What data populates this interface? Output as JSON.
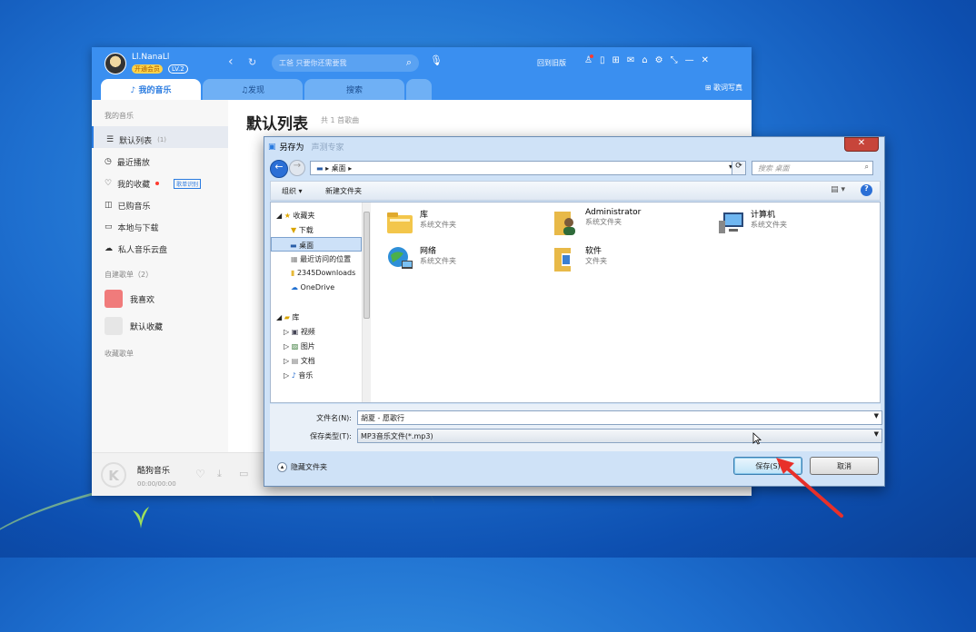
{
  "kugou": {
    "user": {
      "name": "Ll.NanaLl",
      "vip": "开通会员",
      "level": "LV.2"
    },
    "search_placeholder": "工爸 只要你还需要我",
    "top_label": "回到旧版",
    "tabs": [
      "我的音乐",
      "发现",
      "搜索",
      ""
    ],
    "lyrics_label": "歌词写真",
    "sidebar": {
      "section_my": "我的音乐",
      "items": [
        {
          "label": "默认列表",
          "count": "1"
        },
        {
          "label": "最近播放"
        },
        {
          "label": "我的收藏",
          "tag": "歌单识别"
        },
        {
          "label": "已购音乐"
        },
        {
          "label": "本地与下载"
        },
        {
          "label": "私人音乐云盘"
        }
      ],
      "section_created": "自建歌单（2）",
      "playlists": [
        "我喜欢",
        "默认收藏"
      ],
      "section_fav": "收藏歌单"
    },
    "main": {
      "title": "默认列表",
      "count": "共 1 首歌曲"
    },
    "player": {
      "title": "酷狗音乐",
      "time": "00:00/00:00"
    }
  },
  "dialog": {
    "title": "另存为",
    "behind_title": "声测专家",
    "address": "桌面",
    "search_placeholder": "搜索 桌面",
    "organize": "组织 ▾",
    "new_folder": "新建文件夹",
    "nav": [
      {
        "label": "收藏夹",
        "level": 0,
        "icon": "star-icon"
      },
      {
        "label": "下载",
        "level": 1,
        "icon": "download-folder-icon"
      },
      {
        "label": "桌面",
        "level": 1,
        "icon": "desktop-icon",
        "selected": true
      },
      {
        "label": "最近访问的位置",
        "level": 1,
        "icon": "recent-icon"
      },
      {
        "label": "2345Downloads",
        "level": 1,
        "icon": "folder-icon"
      },
      {
        "label": "OneDrive",
        "level": 1,
        "icon": "cloud-icon"
      },
      {
        "label": "库",
        "level": 0,
        "icon": "library-icon"
      },
      {
        "label": "视频",
        "level": 1,
        "icon": "video-icon"
      },
      {
        "label": "图片",
        "level": 1,
        "icon": "picture-icon"
      },
      {
        "label": "文档",
        "level": 1,
        "icon": "document-icon"
      },
      {
        "label": "音乐",
        "level": 1,
        "icon": "music-icon"
      }
    ],
    "files": [
      {
        "name": "库",
        "type": "系统文件夹",
        "icon": "library-icon"
      },
      {
        "name": "Administrator",
        "type": "系统文件夹",
        "icon": "user-folder-icon"
      },
      {
        "name": "计算机",
        "type": "系统文件夹",
        "icon": "computer-icon"
      },
      {
        "name": "网络",
        "type": "系统文件夹",
        "icon": "network-icon"
      },
      {
        "name": "软件",
        "type": "文件夹",
        "icon": "folder-icon"
      }
    ],
    "filename_label": "文件名(N):",
    "filename_value": "胡夏 - 愿歌行",
    "filetype_label": "保存类型(T):",
    "filetype_value": "MP3音乐文件(*.mp3)",
    "hide_folders": "隐藏文件夹",
    "save": "保存(S)",
    "cancel": "取消"
  },
  "colors": {
    "kugou_blue": "#3a8ff0",
    "annotation_arrow": "#e8302a"
  }
}
